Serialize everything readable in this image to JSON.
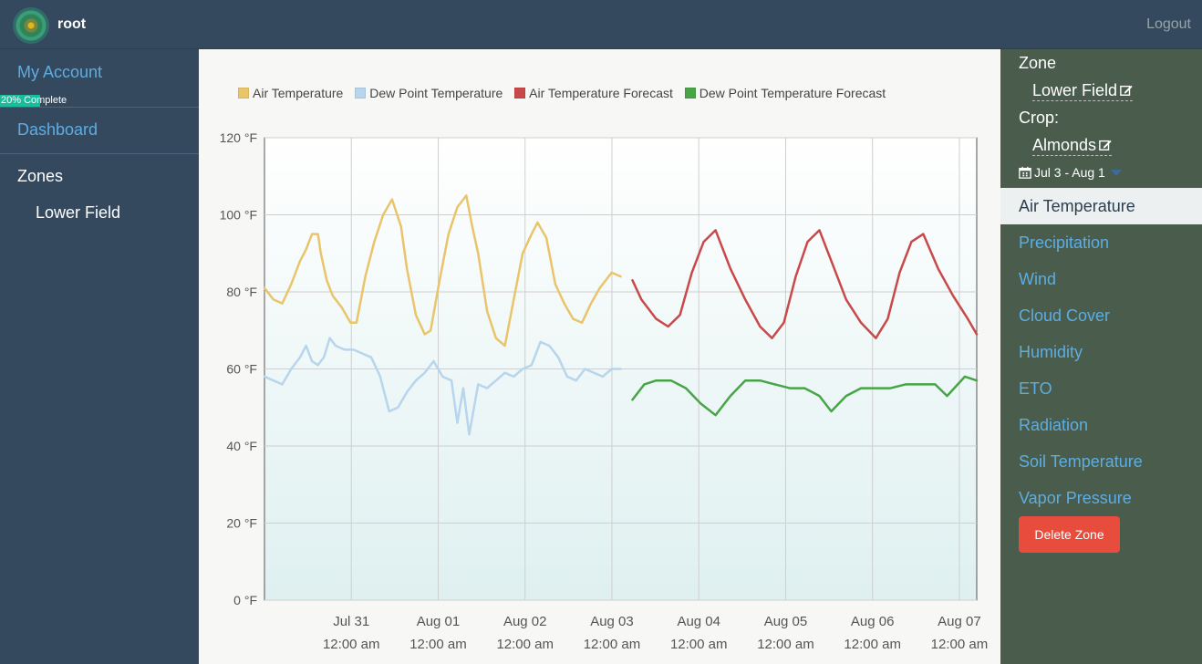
{
  "header": {
    "brand": "root",
    "logout": "Logout"
  },
  "sidebar": {
    "my_account": "My Account",
    "progress": {
      "text": "20% Complete",
      "percent": 20
    },
    "dashboard": "Dashboard",
    "zones_heading": "Zones",
    "zones": [
      "Lower Field"
    ]
  },
  "rightbar": {
    "zone_label": "Zone",
    "zone_value": "Lower Field",
    "crop_label": "Crop:",
    "crop_value": "Almonds",
    "date_range": "Jul 3 - Aug 1",
    "metrics": [
      "Air Temperature",
      "Precipitation",
      "Wind",
      "Cloud Cover",
      "Humidity",
      "ETO",
      "Radiation",
      "Soil Temperature",
      "Vapor Pressure"
    ],
    "active_metric": "Air Temperature",
    "delete_button": "Delete Zone"
  },
  "colors": {
    "air": "#e9c46a",
    "dew": "#b7d5ec",
    "air_fc": "#c9484a",
    "dew_fc": "#47a447",
    "danger": "#e74c3c"
  },
  "chart_data": {
    "type": "line",
    "ylim": [
      0,
      120
    ],
    "xlim": [
      -1.0,
      7.2
    ],
    "y_ticks": [
      {
        "v": 0,
        "label": "0 °F"
      },
      {
        "v": 20,
        "label": "20 °F"
      },
      {
        "v": 40,
        "label": "40 °F"
      },
      {
        "v": 60,
        "label": "60 °F"
      },
      {
        "v": 80,
        "label": "80 °F"
      },
      {
        "v": 100,
        "label": "100 °F"
      },
      {
        "v": 120,
        "label": "120 °F"
      }
    ],
    "x_ticks": [
      {
        "v": 0,
        "date": "Jul 31",
        "time": "12:00 am"
      },
      {
        "v": 1,
        "date": "Aug 01",
        "time": "12:00 am"
      },
      {
        "v": 2,
        "date": "Aug 02",
        "time": "12:00 am"
      },
      {
        "v": 3,
        "date": "Aug 03",
        "time": "12:00 am"
      },
      {
        "v": 4,
        "date": "Aug 04",
        "time": "12:00 am"
      },
      {
        "v": 5,
        "date": "Aug 05",
        "time": "12:00 am"
      },
      {
        "v": 6,
        "date": "Aug 06",
        "time": "12:00 am"
      },
      {
        "v": 7,
        "date": "Aug 07",
        "time": "12:00 am"
      }
    ],
    "series": [
      {
        "name": "Air Temperature",
        "color": "#e9c46a",
        "points": [
          [
            -1.0,
            81
          ],
          [
            -0.85,
            78
          ],
          [
            -0.7,
            77
          ],
          [
            -0.55,
            82
          ],
          [
            -0.4,
            88
          ],
          [
            -0.3,
            91
          ],
          [
            -0.2,
            95
          ],
          [
            -0.1,
            95
          ],
          [
            -0.05,
            90
          ],
          [
            0.05,
            83
          ],
          [
            0.15,
            79
          ],
          [
            0.3,
            76
          ],
          [
            0.45,
            72
          ],
          [
            0.55,
            72
          ],
          [
            0.7,
            84
          ],
          [
            0.85,
            93
          ],
          [
            1.0,
            100
          ],
          [
            1.15,
            104
          ],
          [
            1.3,
            97
          ],
          [
            1.4,
            86
          ],
          [
            1.55,
            74
          ],
          [
            1.7,
            69
          ],
          [
            1.8,
            70
          ],
          [
            1.95,
            83
          ],
          [
            2.1,
            95
          ],
          [
            2.25,
            102
          ],
          [
            2.4,
            105
          ],
          [
            2.5,
            97
          ],
          [
            2.6,
            90
          ],
          [
            2.75,
            75
          ],
          [
            2.9,
            68
          ],
          [
            3.05,
            66
          ],
          [
            3.2,
            78
          ],
          [
            3.35,
            90
          ],
          [
            3.5,
            95
          ],
          [
            3.6,
            98
          ],
          [
            3.75,
            94
          ],
          [
            3.9,
            82
          ],
          [
            4.05,
            77
          ],
          [
            4.2,
            73
          ],
          [
            4.35,
            72
          ],
          [
            4.5,
            77
          ],
          [
            4.65,
            81
          ],
          [
            4.85,
            85
          ],
          [
            5.0,
            84
          ]
        ]
      },
      {
        "name": "Dew Point Temperature",
        "color": "#b7d5ec",
        "points": [
          [
            -1.0,
            58
          ],
          [
            -0.85,
            57
          ],
          [
            -0.7,
            56
          ],
          [
            -0.55,
            60
          ],
          [
            -0.4,
            63
          ],
          [
            -0.3,
            66
          ],
          [
            -0.2,
            62
          ],
          [
            -0.1,
            61
          ],
          [
            0.0,
            63
          ],
          [
            0.1,
            68
          ],
          [
            0.2,
            66
          ],
          [
            0.35,
            65
          ],
          [
            0.5,
            65
          ],
          [
            0.65,
            64
          ],
          [
            0.8,
            63
          ],
          [
            0.95,
            58
          ],
          [
            1.1,
            49
          ],
          [
            1.25,
            50
          ],
          [
            1.4,
            54
          ],
          [
            1.55,
            57
          ],
          [
            1.7,
            59
          ],
          [
            1.85,
            62
          ],
          [
            2.0,
            58
          ],
          [
            2.15,
            57
          ],
          [
            2.25,
            46
          ],
          [
            2.35,
            55
          ],
          [
            2.45,
            43
          ],
          [
            2.6,
            56
          ],
          [
            2.75,
            55
          ],
          [
            2.9,
            57
          ],
          [
            3.05,
            59
          ],
          [
            3.2,
            58
          ],
          [
            3.35,
            60
          ],
          [
            3.5,
            61
          ],
          [
            3.65,
            67
          ],
          [
            3.8,
            66
          ],
          [
            3.95,
            63
          ],
          [
            4.1,
            58
          ],
          [
            4.25,
            57
          ],
          [
            4.4,
            60
          ],
          [
            4.55,
            59
          ],
          [
            4.7,
            58
          ],
          [
            4.85,
            60
          ],
          [
            5.0,
            60
          ]
        ]
      },
      {
        "name": "Air Temperature Forecast",
        "color": "#c9484a",
        "points": [
          [
            5.2,
            83
          ],
          [
            5.35,
            78
          ],
          [
            5.6,
            73
          ],
          [
            5.8,
            71
          ],
          [
            6.0,
            74
          ],
          [
            6.2,
            85
          ],
          [
            6.4,
            93
          ],
          [
            6.6,
            96
          ],
          [
            6.85,
            86
          ],
          [
            7.1,
            78
          ],
          [
            7.35,
            71
          ],
          [
            7.55,
            68
          ],
          [
            7.75,
            72
          ],
          [
            7.95,
            84
          ],
          [
            8.15,
            93
          ],
          [
            8.35,
            96
          ],
          [
            8.6,
            86
          ],
          [
            8.8,
            78
          ],
          [
            9.05,
            72
          ],
          [
            9.3,
            68
          ],
          [
            9.5,
            73
          ],
          [
            9.7,
            85
          ],
          [
            9.9,
            93
          ],
          [
            10.1,
            95
          ],
          [
            10.35,
            86
          ],
          [
            10.6,
            79
          ],
          [
            10.85,
            73
          ],
          [
            11.0,
            69
          ]
        ]
      },
      {
        "name": "Dew Point Temperature Forecast",
        "color": "#47a447",
        "points": [
          [
            5.2,
            52
          ],
          [
            5.4,
            56
          ],
          [
            5.6,
            57
          ],
          [
            5.85,
            57
          ],
          [
            6.1,
            55
          ],
          [
            6.35,
            51
          ],
          [
            6.6,
            48
          ],
          [
            6.85,
            53
          ],
          [
            7.1,
            57
          ],
          [
            7.35,
            57
          ],
          [
            7.6,
            56
          ],
          [
            7.85,
            55
          ],
          [
            8.1,
            55
          ],
          [
            8.35,
            53
          ],
          [
            8.55,
            49
          ],
          [
            8.8,
            53
          ],
          [
            9.05,
            55
          ],
          [
            9.3,
            55
          ],
          [
            9.55,
            55
          ],
          [
            9.8,
            56
          ],
          [
            10.05,
            56
          ],
          [
            10.3,
            56
          ],
          [
            10.5,
            53
          ],
          [
            10.8,
            58
          ],
          [
            11.0,
            57
          ]
        ]
      }
    ]
  }
}
